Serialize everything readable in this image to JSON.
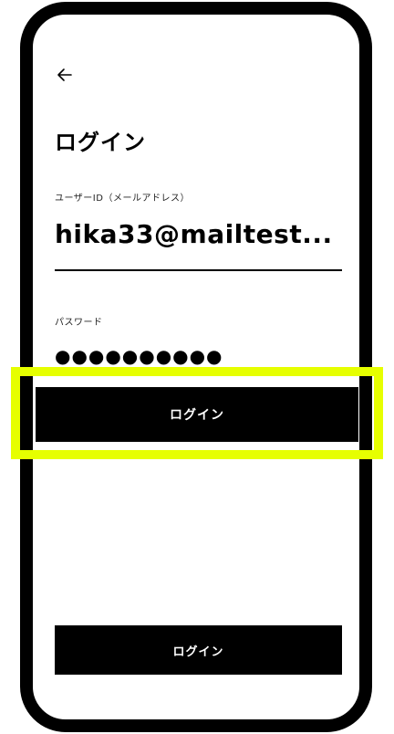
{
  "header": {
    "back_icon": "arrow-left-icon",
    "title": "ログイン"
  },
  "form": {
    "userid_label": "ユーザーID（メールアドレス）",
    "userid_value": "hika33@mailtest...",
    "password_label": "パスワード",
    "password_value": "●●●●●●●●●●"
  },
  "buttons": {
    "login_highlighted_label": "ログイン",
    "login_bottom_label": "ログイン"
  },
  "colors": {
    "highlight": "#e6ff00",
    "button_bg": "#000000",
    "button_text": "#ffffff"
  }
}
